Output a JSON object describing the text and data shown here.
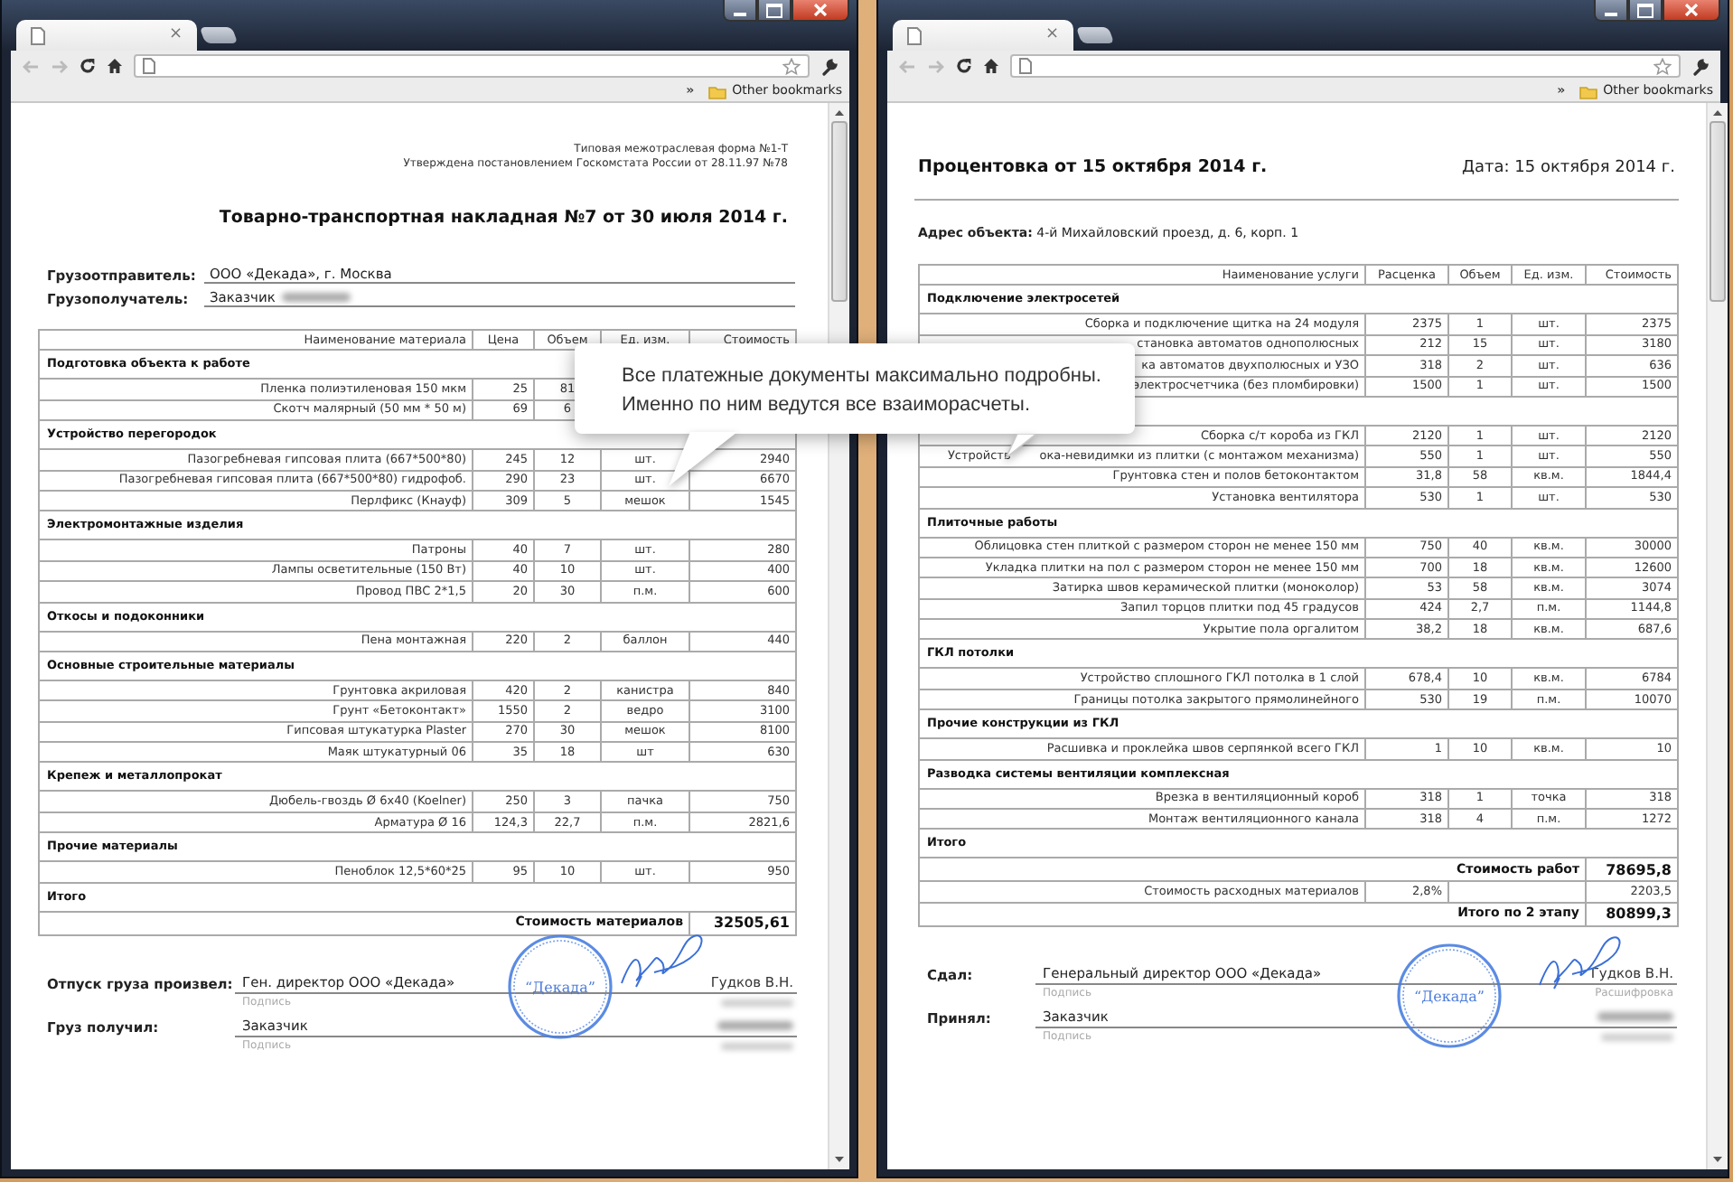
{
  "windows": [
    {
      "tab_close": "×",
      "bookmarks_chevron": "»",
      "bookmarks_folder": "Other bookmarks",
      "document": {
        "kind": "waybill",
        "form_note": [
          "Типовая межотраслевая форма №1-Т",
          "Утверждена постановлением Госкомстата России от 28.11.97 №78"
        ],
        "title": "Товарно-транспортная накладная №7 от 30 июля 2014 г.",
        "parties": [
          {
            "label": "Грузоотправитель:",
            "value": "ООО «Декада», г. Москва",
            "redacted": false
          },
          {
            "label": "Грузополучатель:",
            "value": "Заказчик",
            "redacted": true
          }
        ],
        "table": {
          "columns": [
            "Наименование материала",
            "Цена",
            "Объем",
            "Ед. изм.",
            "Стоимость"
          ],
          "sections": [
            {
              "title": "Подготовка объекта к работе",
              "rows": [
                {
                  "name": "Пленка полиэтиленовая 150 мкм",
                  "price": "25",
                  "volume": "81"
                },
                {
                  "name": "Скотч малярный (50 мм * 50 м)",
                  "price": "69",
                  "volume": "6"
                }
              ]
            },
            {
              "title": "Устройство перегородок",
              "rows": [
                {
                  "name": "Пазогребневая гипсовая плита (667*500*80)",
                  "price": "245",
                  "volume": "12",
                  "unit": "шт.",
                  "cost": "2940"
                },
                {
                  "name": "Пазогребневая гипсовая плита (667*500*80) гидрофоб.",
                  "price": "290",
                  "volume": "23",
                  "unit": "шт.",
                  "cost": "6670"
                },
                {
                  "name": "Перлфикс (Кнауф)",
                  "price": "309",
                  "volume": "5",
                  "unit": "мешок",
                  "cost": "1545"
                }
              ]
            },
            {
              "title": "Электромонтажные изделия",
              "rows": [
                {
                  "name": "Патроны",
                  "price": "40",
                  "volume": "7",
                  "unit": "шт.",
                  "cost": "280"
                },
                {
                  "name": "Лампы осветительные (150 Вт)",
                  "price": "40",
                  "volume": "10",
                  "unit": "шт.",
                  "cost": "400"
                },
                {
                  "name": "Провод ПВС 2*1,5",
                  "price": "20",
                  "volume": "30",
                  "unit": "п.м.",
                  "cost": "600"
                }
              ]
            },
            {
              "title": "Откосы и подоконники",
              "rows": [
                {
                  "name": "Пена монтажная",
                  "price": "220",
                  "volume": "2",
                  "unit": "баллон",
                  "cost": "440"
                }
              ]
            },
            {
              "title": "Основные строительные материалы",
              "rows": [
                {
                  "name": "Грунтовка акриловая",
                  "price": "420",
                  "volume": "2",
                  "unit": "канистра",
                  "cost": "840"
                },
                {
                  "name": "Грунт «Бетоконтакт»",
                  "price": "1550",
                  "volume": "2",
                  "unit": "ведро",
                  "cost": "3100"
                },
                {
                  "name": "Гипсовая штукатурка Plaster",
                  "price": "270",
                  "volume": "30",
                  "unit": "мешок",
                  "cost": "8100"
                },
                {
                  "name": "Маяк штукатурный 06",
                  "price": "35",
                  "volume": "18",
                  "unit": "шт",
                  "cost": "630"
                }
              ]
            },
            {
              "title": "Крепеж и металлопрокат",
              "rows": [
                {
                  "name": "Дюбель-гвоздь Ø 6х40 (Koelner)",
                  "price": "250",
                  "volume": "3",
                  "unit": "пачка",
                  "cost": "750"
                },
                {
                  "name": "Арматура Ø 16",
                  "price": "124,3",
                  "volume": "22,7",
                  "unit": "п.м.",
                  "cost": "2821,6"
                }
              ]
            },
            {
              "title": "Прочие материалы",
              "rows": [
                {
                  "name": "Пеноблок 12,5*60*25",
                  "price": "95",
                  "volume": "10",
                  "unit": "шт.",
                  "cost": "950"
                }
              ]
            },
            {
              "title": "Итого"
            }
          ],
          "totals": [
            {
              "kind": "sum",
              "label": "Стоимость материалов",
              "value": "32505,61"
            }
          ]
        },
        "signatures": [
          {
            "label": "Отпуск груза произвел:",
            "position": "Ген. директор ООО «Декада»",
            "caption": "Подпись",
            "name": "Гудков В.Н.",
            "name_redacted": false,
            "decoding_redacted": true
          },
          {
            "label": "Груз получил:",
            "position": "Заказчик",
            "caption": "Подпись",
            "name_redacted": true,
            "decoding_redacted": true
          }
        ],
        "stamp_text": "“Декада”"
      }
    },
    {
      "tab_close": "×",
      "bookmarks_chevron": "»",
      "bookmarks_folder": "Other bookmarks",
      "document": {
        "kind": "statement",
        "title": "Процентовка от 15 октября 2014 г.",
        "date": "Дата: 15 октября 2014 г.",
        "address": "**Адрес объекта:** 4-й Михайловский проезд, д. 6, корп. 1",
        "table": {
          "columns": [
            "Наименование услуги",
            "Расценка",
            "Объем",
            "Ед. изм.",
            "Стоимость"
          ],
          "sections": [
            {
              "title": "Подключение электросетей",
              "rows": [
                {
                  "name": "Сборка и подключение щитка на 24 модуля",
                  "price": "2375",
                  "volume": "1",
                  "unit": "шт.",
                  "cost": "2375"
                },
                {
                  "name": "становка автоматов однополюсных",
                  "price": "212",
                  "volume": "15",
                  "unit": "шт.",
                  "cost": "3180"
                },
                {
                  "name": "ка автоматов двухполюсных и УЗО",
                  "price": "318",
                  "volume": "2",
                  "unit": "шт.",
                  "cost": "636"
                },
                {
                  "name": "электросчетчика (без пломбировки)",
                  "price": "1500",
                  "volume": "1",
                  "unit": "шт.",
                  "cost": "1500"
                }
              ]
            },
            {
              "rows": [
                {
                  "name": "Сборка с/т короба из ГКЛ",
                  "price": "2120",
                  "volume": "1",
                  "unit": "шт.",
                  "cost": "2120"
                },
                {
                  "name_lead": "Устройств",
                  "name": "ока-невидимки из плитки (с монтажом механизма)",
                  "price": "550",
                  "volume": "1",
                  "unit": "шт.",
                  "cost": "550"
                },
                {
                  "name": "Грунтовка стен и полов бетоконтактом",
                  "price": "31,8",
                  "volume": "58",
                  "unit": "кв.м.",
                  "cost": "1844,4"
                },
                {
                  "name": "Установка вентилятора",
                  "price": "530",
                  "volume": "1",
                  "unit": "шт.",
                  "cost": "530"
                }
              ]
            },
            {
              "title": "Плиточные работы",
              "rows": [
                {
                  "name": "Облицовка стен плиткой с размером сторон не менее 150 мм",
                  "price": "750",
                  "volume": "40",
                  "unit": "кв.м.",
                  "cost": "30000"
                },
                {
                  "name": "Укладка плитки на пол с размером сторон не менее 150 мм",
                  "price": "700",
                  "volume": "18",
                  "unit": "кв.м.",
                  "cost": "12600"
                },
                {
                  "name": "Затирка швов керамической плитки (моноколор)",
                  "price": "53",
                  "volume": "58",
                  "unit": "кв.м.",
                  "cost": "3074"
                },
                {
                  "name": "Запил торцов плитки под 45 градусов",
                  "price": "424",
                  "volume": "2,7",
                  "unit": "п.м.",
                  "cost": "1144,8"
                },
                {
                  "name": "Укрытие пола оргалитом",
                  "price": "38,2",
                  "volume": "18",
                  "unit": "кв.м.",
                  "cost": "687,6"
                }
              ]
            },
            {
              "title": "ГКЛ потолки",
              "rows": [
                {
                  "name": "Устройство сплошного ГКЛ потолка в 1 слой",
                  "price": "678,4",
                  "volume": "10",
                  "unit": "кв.м.",
                  "cost": "6784"
                },
                {
                  "name": "Границы потолка закрытого прямолинейного",
                  "price": "530",
                  "volume": "19",
                  "unit": "п.м.",
                  "cost": "10070"
                }
              ]
            },
            {
              "title": "Прочие конструкции из ГКЛ",
              "rows": [
                {
                  "name": "Расшивка и проклейка швов серпянкой всего ГКЛ",
                  "price": "1",
                  "volume": "10",
                  "unit": "кв.м.",
                  "cost": "10"
                }
              ]
            },
            {
              "title": "Разводка системы вентиляции комплексная",
              "rows": [
                {
                  "name": "Врезка в вентиляционный короб",
                  "price": "318",
                  "volume": "1",
                  "unit": "точка",
                  "cost": "318"
                },
                {
                  "name": "Монтаж вентиляционного канала",
                  "price": "318",
                  "volume": "4",
                  "unit": "п.м.",
                  "cost": "1272"
                }
              ]
            },
            {
              "title": "Итого"
            }
          ],
          "totals": [
            {
              "kind": "sum",
              "label": "Стоимость работ",
              "value": "78695,8"
            },
            {
              "kind": "rate",
              "label": "Стоимость расходных материалов",
              "rate": "2,8%",
              "value": "2203,5"
            },
            {
              "kind": "sum",
              "label": "Итого по 2 этапу",
              "value": "80899,3"
            }
          ]
        },
        "signatures": [
          {
            "label": "Сдал:",
            "position": "Генеральный директор ООО «Декада»",
            "caption": "Подпись",
            "name": "Гудков В.Н.",
            "name_redacted": false,
            "decoding": "Расшифровка",
            "decoding_redacted": false
          },
          {
            "label": "Принял:",
            "position": "Заказчик",
            "caption": "Подпись",
            "name_redacted": true,
            "decoding_redacted": true
          }
        ],
        "stamp_text": "“Декада”"
      }
    }
  ],
  "callout": {
    "lines": [
      "Все платежные документы максимально подробны.",
      "Именно по ним ведутся все взаиморасчеты."
    ]
  }
}
